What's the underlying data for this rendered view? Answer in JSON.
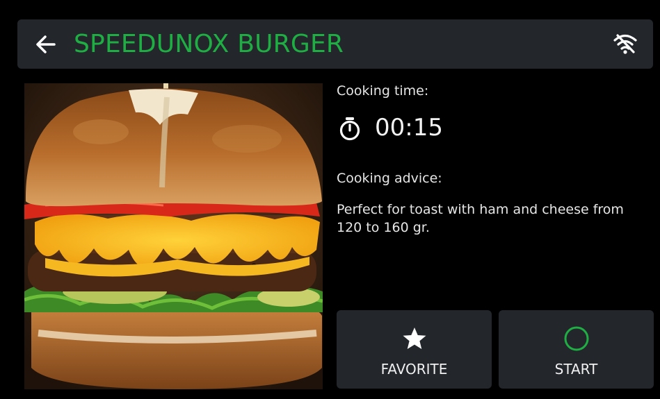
{
  "header": {
    "title": "SPEEDUNOX BURGER",
    "back_icon": "arrow-left-icon",
    "status_icon": "wifi-off-icon"
  },
  "recipe_image": {
    "subject": "burger-photo"
  },
  "cooking_time": {
    "label": "Cooking time:",
    "value": "00:15",
    "icon": "stopwatch-icon"
  },
  "cooking_advice": {
    "label": "Cooking advice:",
    "text": "Perfect for toast with ham and cheese from 120 to 160 gr."
  },
  "actions": {
    "favorite": {
      "label": "FAVORITE",
      "icon": "star-icon"
    },
    "start": {
      "label": "START",
      "icon": "circle-icon"
    }
  },
  "colors": {
    "accent_green": "#1fae43",
    "panel": "#23272c",
    "background": "#000000"
  }
}
